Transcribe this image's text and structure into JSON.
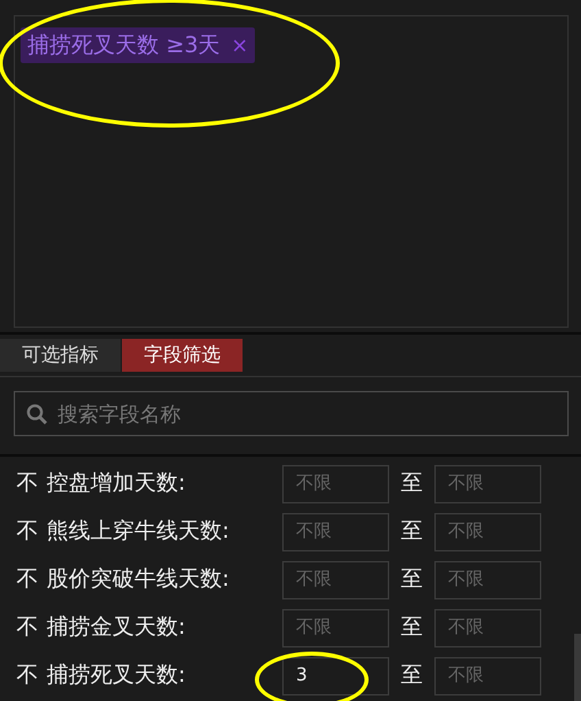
{
  "selected_filters": [
    {
      "label": "捕捞死叉天数 ≥3天",
      "remove": "×",
      "highlight": true
    }
  ],
  "tabs": [
    {
      "label": "可选指标",
      "selected": false
    },
    {
      "label": "字段筛选",
      "selected": true
    }
  ],
  "search": {
    "placeholder": "搜索字段名称"
  },
  "fields": [
    {
      "prefix": "不",
      "label": "控盘增加天数:",
      "min": {
        "placeholder": "不限"
      },
      "separator": "至",
      "max": {
        "placeholder": "不限"
      }
    },
    {
      "prefix": "不",
      "label": "熊线上穿牛线天数:",
      "min": {
        "placeholder": "不限"
      },
      "separator": "至",
      "max": {
        "placeholder": "不限"
      }
    },
    {
      "prefix": "不",
      "label": "股价突破牛线天数:",
      "min": {
        "placeholder": "不限"
      },
      "separator": "至",
      "max": {
        "placeholder": "不限"
      }
    },
    {
      "prefix": "不",
      "label": "捕捞金叉天数:",
      "min": {
        "placeholder": "不限"
      },
      "separator": "至",
      "max": {
        "placeholder": "不限"
      }
    },
    {
      "prefix": "不",
      "label": "捕捞死叉天数:",
      "min": {
        "value": "3",
        "highlight": true
      },
      "separator": "至",
      "max": {
        "placeholder": "不限"
      }
    }
  ]
}
